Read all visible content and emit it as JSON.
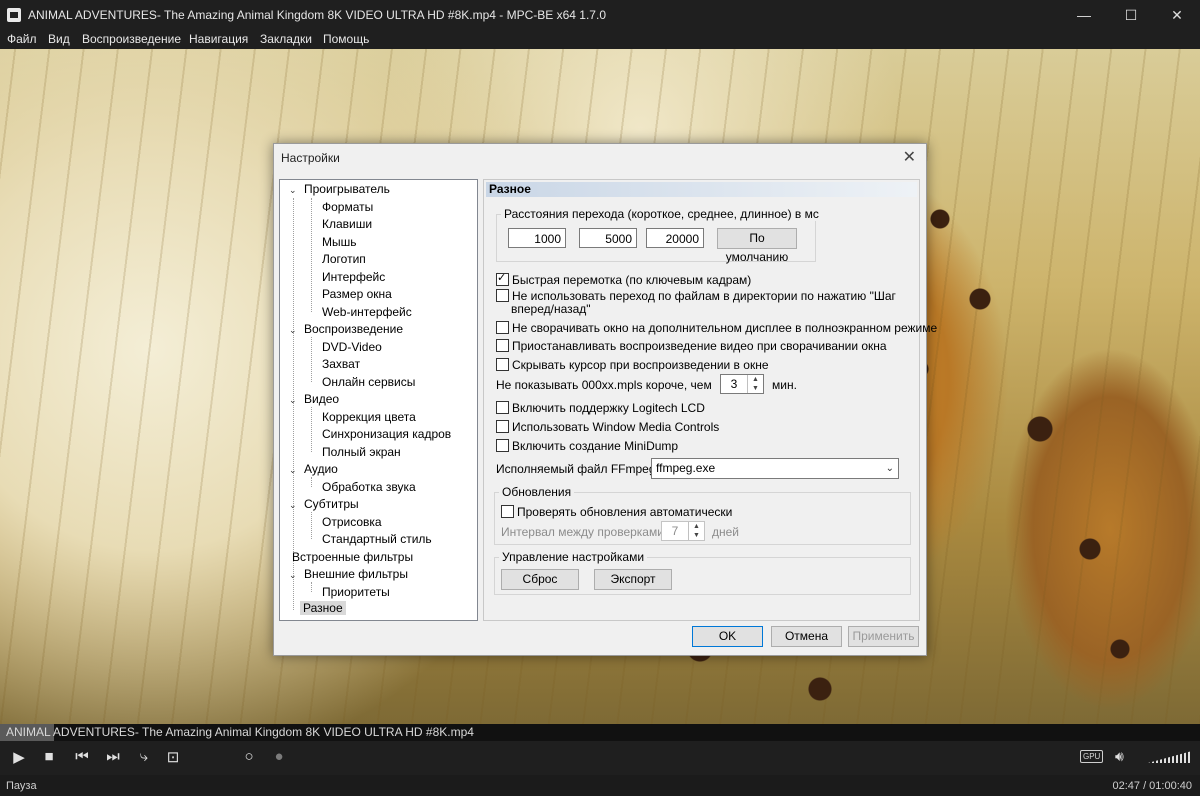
{
  "window": {
    "title": "ANIMAL ADVENTURES- The Amazing Animal Kingdom 8K VIDEO ULTRA HD #8K.mp4 - MPC-BE x64 1.7.0",
    "minimize": "—",
    "maximize": "☐",
    "close": "✕"
  },
  "menu": [
    "Файл",
    "Вид",
    "Воспроизведение",
    "Навигация",
    "Закладки",
    "Помощь"
  ],
  "dialog": {
    "title": "Настройки",
    "close": "✕",
    "tree": [
      {
        "label": "Проигрыватель",
        "level": 0
      },
      {
        "label": "Форматы",
        "level": 1
      },
      {
        "label": "Клавиши",
        "level": 1
      },
      {
        "label": "Мышь",
        "level": 1
      },
      {
        "label": "Логотип",
        "level": 1
      },
      {
        "label": "Интерфейс",
        "level": 1
      },
      {
        "label": "Размер окна",
        "level": 1
      },
      {
        "label": "Web-интерфейс",
        "level": 1
      },
      {
        "label": "Воспроизведение",
        "level": 0
      },
      {
        "label": "DVD-Video",
        "level": 1
      },
      {
        "label": "Захват",
        "level": 1
      },
      {
        "label": "Онлайн сервисы",
        "level": 1
      },
      {
        "label": "Видео",
        "level": 0
      },
      {
        "label": "Коррекция цвета",
        "level": 1
      },
      {
        "label": "Синхронизация кадров",
        "level": 1
      },
      {
        "label": "Полный экран",
        "level": 1
      },
      {
        "label": "Аудио",
        "level": 0
      },
      {
        "label": "Обработка звука",
        "level": 1
      },
      {
        "label": "Субтитры",
        "level": 0
      },
      {
        "label": "Отрисовка",
        "level": 1
      },
      {
        "label": "Стандартный стиль",
        "level": 1
      },
      {
        "label": "Встроенные фильтры",
        "level": 0
      },
      {
        "label": "Внешние фильтры",
        "level": 0
      },
      {
        "label": "Приоритеты",
        "level": 1
      },
      {
        "label": "Разное",
        "level": 0
      }
    ],
    "panel_header": "Разное",
    "jump_group_label": "Расстояния перехода (короткое, среднее, длинное) в мс",
    "jump_short": "1000",
    "jump_medium": "5000",
    "jump_long": "20000",
    "default_button": "По умолчанию",
    "opt_fast_seek": "Быстрая перемотка (по ключевым кадрам)",
    "opt_no_file_step": "Не использовать переход по файлам в директории по нажатию \"Шаг",
    "opt_no_file_step_2": "вперед/назад\"",
    "opt_no_minimize": "Не сворачивать окно на дополнительном дисплее в полноэкранном режиме",
    "opt_pause_minimized": "Приостанавливать воспроизведение видео при сворачивании окна",
    "opt_hide_cursor": "Скрывать курсор при воспроизведении в окне",
    "mpls_label": "Не показывать 000xx.mpls короче, чем",
    "mpls_value": "3",
    "mpls_unit": "мин.",
    "opt_logitech": "Включить поддержку Logitech LCD",
    "opt_wmc": "Использовать Window Media Controls",
    "opt_minidump": "Включить создание MiniDump",
    "ffmpeg_label": "Исполняемый файл FFmpeg:",
    "ffmpeg_value": "ffmpeg.exe",
    "updates_group": "Обновления",
    "opt_auto_update": "Проверять обновления автоматически",
    "update_interval_label": "Интервал между проверками:",
    "update_interval_value": "7",
    "update_interval_unit": "дней",
    "manage_group": "Управление настройками",
    "reset_button": "Сброс",
    "export_button": "Экспорт",
    "ok_button": "OK",
    "cancel_button": "Отмена",
    "apply_button": "Применить",
    "checked": {
      "fast_seek": true
    }
  },
  "player": {
    "file_name": "ANIMAL ADVENTURES- The Amazing Animal Kingdom 8K VIDEO ULTRA HD #8K.mp4",
    "progress_fraction": 0.045,
    "gpu_badge": "GPU",
    "status": "Пауза",
    "time": "02:47 / 01:00:40"
  }
}
